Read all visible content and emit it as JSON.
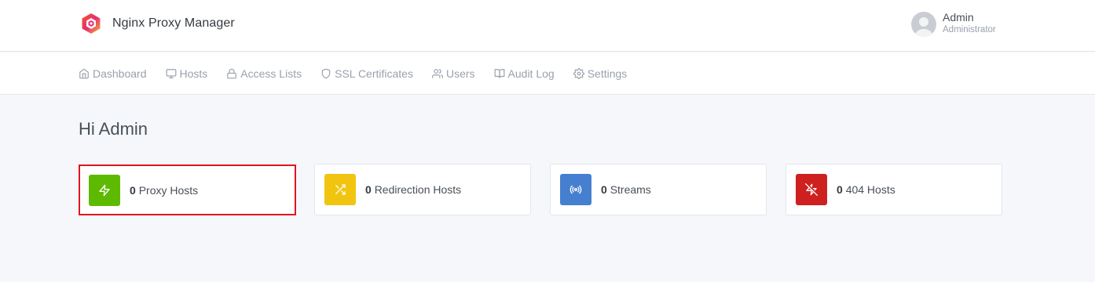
{
  "app": {
    "title": "Nginx Proxy Manager",
    "logo_icon": "nginx-proxy-manager-logo"
  },
  "user": {
    "name": "Admin",
    "role": "Administrator",
    "avatar_icon": "user-avatar-icon"
  },
  "nav": {
    "items": [
      {
        "label": "Dashboard",
        "icon": "home-icon"
      },
      {
        "label": "Hosts",
        "icon": "monitor-icon"
      },
      {
        "label": "Access Lists",
        "icon": "lock-icon"
      },
      {
        "label": "SSL Certificates",
        "icon": "shield-icon"
      },
      {
        "label": "Users",
        "icon": "users-icon"
      },
      {
        "label": "Audit Log",
        "icon": "book-icon"
      },
      {
        "label": "Settings",
        "icon": "settings-icon"
      }
    ]
  },
  "page": {
    "greeting": "Hi Admin"
  },
  "stats": [
    {
      "count": "0",
      "label": "Proxy Hosts",
      "icon": "zap-icon",
      "color": "#5eba00",
      "highlighted": true
    },
    {
      "count": "0",
      "label": "Redirection Hosts",
      "icon": "shuffle-icon",
      "color": "#f1c40f"
    },
    {
      "count": "0",
      "label": "Streams",
      "icon": "radio-icon",
      "color": "#467fcf"
    },
    {
      "count": "0",
      "label": "404 Hosts",
      "icon": "zap-off-icon",
      "color": "#cd201f"
    }
  ],
  "colors": {
    "highlight_border": "#e2141f",
    "page_bg": "#f5f7fb"
  }
}
